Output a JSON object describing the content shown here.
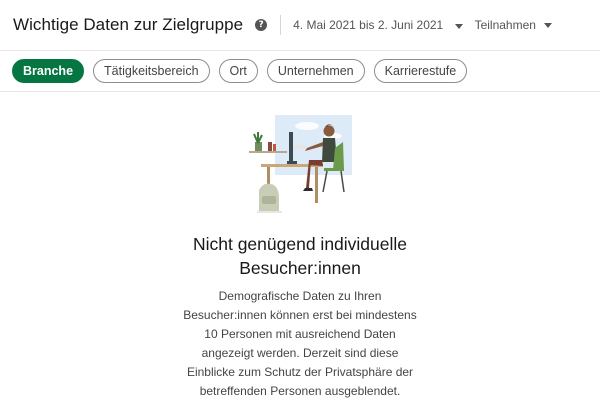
{
  "header": {
    "title": "Wichtige Daten zur Zielgruppe",
    "help_icon": "question-circle-icon",
    "date_range": "4. Mai 2021 bis 2. Juni 2021",
    "metric": "Teilnahmen"
  },
  "filters": {
    "active": "Branche",
    "items": [
      {
        "label": "Branche"
      },
      {
        "label": "Tätigkeitsbereich"
      },
      {
        "label": "Ort"
      },
      {
        "label": "Unternehmen"
      },
      {
        "label": "Karrierestufe"
      }
    ]
  },
  "empty_state": {
    "illustration": "person-at-desk-illustration",
    "title_line1": "Nicht genügend individuelle",
    "title_line2": "Besucher:innen",
    "desc_lines": [
      "Demografische Daten zu Ihren",
      "Besucher:innen können erst bei mindestens",
      "10 Personen mit ausreichend Daten",
      "angezeigt werden. Derzeit sind diese",
      "Einblicke zum Schutz der Privatsphäre der",
      "betreffenden Personen ausgeblendet."
    ]
  },
  "colors": {
    "accent": "#057642",
    "text": "#191919",
    "muted": "#555555"
  }
}
